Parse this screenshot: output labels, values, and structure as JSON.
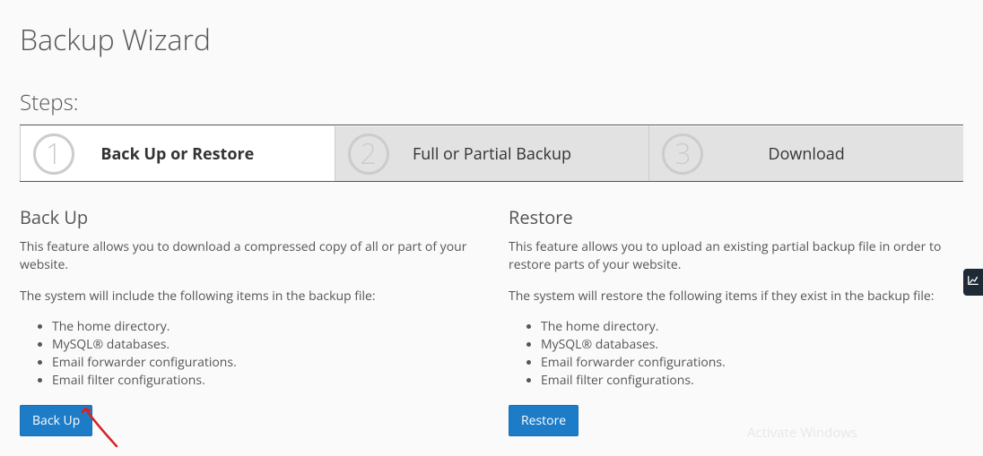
{
  "page_title": "Backup Wizard",
  "steps_label": "Steps:",
  "steps": [
    {
      "num": "1",
      "title": "Back Up or Restore",
      "active": true
    },
    {
      "num": "2",
      "title": "Full or Partial Backup",
      "active": false
    },
    {
      "num": "3",
      "title": "Download",
      "active": false
    }
  ],
  "backup": {
    "heading": "Back Up",
    "desc": "This feature allows you to download a compressed copy of all or part of your website.",
    "intro": "The system will include the following items in the backup file:",
    "items": [
      "The home directory.",
      "MySQL® databases.",
      "Email forwarder configurations.",
      "Email filter configurations."
    ],
    "button": "Back Up"
  },
  "restore": {
    "heading": "Restore",
    "desc": "This feature allows you to upload an existing partial backup file in order to restore parts of your website.",
    "intro": "The system will restore the following items if they exist in the backup file:",
    "items": [
      "The home directory.",
      "MySQL® databases.",
      "Email forwarder configurations.",
      "Email filter configurations."
    ],
    "button": "Restore"
  },
  "watermark": "Activate Windows"
}
